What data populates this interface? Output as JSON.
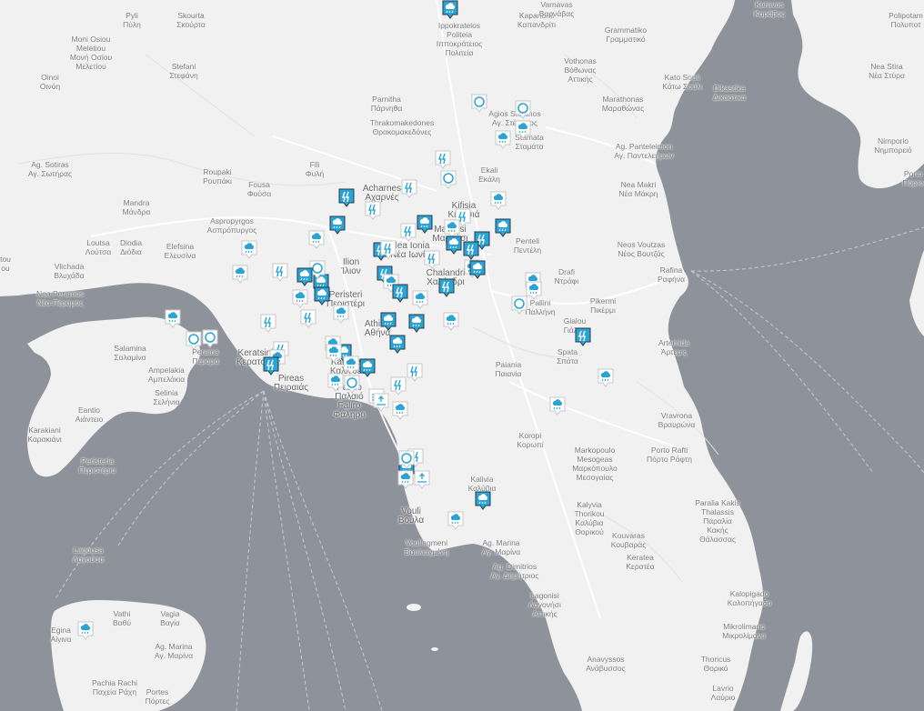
{
  "map": {
    "colors": {
      "sea": "#8e929a",
      "land": "#f1f1f1",
      "road": "#ffffff",
      "accent": "#2aa3d6",
      "markerDark": "#2b3a45"
    },
    "places": [
      {
        "id": "pyli",
        "l1": "Pyli",
        "l2": "Πύλη"
      },
      {
        "id": "skourta",
        "l1": "Skourta",
        "l2": "Σκούρτα"
      },
      {
        "id": "ippokrateios",
        "l1": "Ippokrateios",
        "l2": "Politeia",
        "l3": "Ιπποκράτειος",
        "l4": "Πολιτεία"
      },
      {
        "id": "kapandriti",
        "l1": "Kapandriti",
        "l2": "Καπανδρίτι"
      },
      {
        "id": "varnavas",
        "l1": "Varnavas",
        "l2": "Βαρνάβας"
      },
      {
        "id": "grammatiko",
        "l1": "Grammatiko",
        "l2": "Γραμματικό"
      },
      {
        "id": "polipotamos",
        "l1": "Polipotam",
        "l2": "Πολυποτ"
      },
      {
        "id": "moni",
        "l1": "Moni Osiou",
        "l2": "Meletiou",
        "l3": "Μονή Οσίου",
        "l4": "Μελετίου"
      },
      {
        "id": "stefani",
        "l1": "Stefani",
        "l2": "Στεφάνη"
      },
      {
        "id": "oinoi",
        "l1": "Oinoi",
        "l2": "Οινόη"
      },
      {
        "id": "vothonas",
        "l1": "Vothonas",
        "l2": "Βόθωνας",
        "l3": "Αττικής"
      },
      {
        "id": "katosouli",
        "l1": "Kato Souli",
        "l2": "Κάτω Σούλι"
      },
      {
        "id": "dikastika",
        "l1": "Dikastika",
        "l2": "Δικαστικα"
      },
      {
        "id": "neastira",
        "l1": "Nea Stira",
        "l2": "Νέα Στύρα"
      },
      {
        "id": "parnitha",
        "l1": "Parnitha",
        "l2": "Πάρνηθα"
      },
      {
        "id": "marathonas",
        "l1": "Marathonas",
        "l2": "Μαραθώνας"
      },
      {
        "id": "thrakomakedones",
        "l1": "Thrakomakedones",
        "l2": "Θρακομακεδόνες"
      },
      {
        "id": "agstefanos",
        "l1": "Agios Stefanos",
        "l2": "Αγ. Στέφανος"
      },
      {
        "id": "stamata",
        "l1": "Stamata",
        "l2": "Σταμάτα"
      },
      {
        "id": "nimporio",
        "l1": "Nimporio",
        "l2": "Νημπορειό"
      },
      {
        "id": "agsotiras",
        "l1": "Ag. Sotiras",
        "l2": "Αγ. Σωτήρας"
      },
      {
        "id": "fili",
        "l1": "Fili",
        "l2": "Φυλή"
      },
      {
        "id": "agpanteleimon",
        "l1": "Ag. Panteleimon",
        "l2": "Αγ. Παντελεήμων"
      },
      {
        "id": "ekali",
        "l1": "Ekali",
        "l2": "Εκάλη"
      },
      {
        "id": "roupaki",
        "l1": "Roupaki",
        "l2": "Ρουπάκι"
      },
      {
        "id": "fousa",
        "l1": "Fousa",
        "l2": "Φούσα"
      },
      {
        "id": "acharnes",
        "l1": "Acharnes",
        "l2": "Αχαρνές"
      },
      {
        "id": "neamakri",
        "l1": "Nea Makri",
        "l2": "Νέα Μάκρη"
      },
      {
        "id": "porto",
        "l1": "Porto",
        "l2": "Πόρτο"
      },
      {
        "id": "mandra",
        "l1": "Mandra",
        "l2": "Μάνδρα"
      },
      {
        "id": "kifisia",
        "l1": "Kifisia",
        "l2": "Κηφισιά"
      },
      {
        "id": "aspropyrgos",
        "l1": "Aspropyrgos",
        "l2": "Ασπρόπυργος"
      },
      {
        "id": "marousi",
        "l1": "Marousi",
        "l2": "Μαρούσι"
      },
      {
        "id": "penteli",
        "l1": "Penteli",
        "l2": "Πεντέλη"
      },
      {
        "id": "loutsa",
        "l1": "Loutsa",
        "l2": "Λούτσα"
      },
      {
        "id": "diodia",
        "l1": "Diodia",
        "l2": "Διόδια"
      },
      {
        "id": "elefsina",
        "l1": "Elefsina",
        "l2": "Ελευσίνα"
      },
      {
        "id": "neosvoutzas",
        "l1": "Neos Voutzas",
        "l2": "Νέος Βουτζάς"
      },
      {
        "id": "metamorfosi",
        "l1": "Nea Ionia",
        "l2": "Νέα Ιωνία"
      },
      {
        "id": "outou",
        "l1": "tou",
        "l2": "ου"
      },
      {
        "id": "vlichada",
        "l1": "Vlichada",
        "l2": "Βλυχάδα"
      },
      {
        "id": "ilion",
        "l1": "Ilion",
        "l2": "Ίλιον"
      },
      {
        "id": "chalandri",
        "l1": "Chalandri",
        "l2": "Χαλάνδρι"
      },
      {
        "id": "drafi",
        "l1": "Drafi",
        "l2": "Ντράφι"
      },
      {
        "id": "rafina",
        "l1": "Rafina",
        "l2": "Ραφήνα"
      },
      {
        "id": "neaperamos",
        "l1": "Nea Peramos",
        "l2": "Νέα Πέραμος"
      },
      {
        "id": "peristeri",
        "l1": "Peristeri",
        "l2": "Περιστέρι"
      },
      {
        "id": "pikermi",
        "l1": "Pikermi",
        "l2": "Πικέρμι"
      },
      {
        "id": "pallini",
        "l1": "Pallini",
        "l2": "Παλλήνη"
      },
      {
        "id": "gialou",
        "l1": "Gialou",
        "l2": "Γιάλου"
      },
      {
        "id": "athina",
        "l1": "Athina",
        "l2": "Αθήνα"
      },
      {
        "id": "salamina",
        "l1": "Salamina",
        "l2": "Σαλαμίνα"
      },
      {
        "id": "perama",
        "l1": "Perama",
        "l2": "Πέραμα"
      },
      {
        "id": "keratsini",
        "l1": "Keratsini",
        "l2": "Κερατσίνι"
      },
      {
        "id": "spata",
        "l1": "Spata",
        "l2": "Σπάτα"
      },
      {
        "id": "artemida",
        "l1": "Artemida",
        "l2": "Άρτεμις"
      },
      {
        "id": "ampelakia",
        "l1": "Ampelakia",
        "l2": "Αμπελάκια"
      },
      {
        "id": "kallithea",
        "l1": "Kallithea",
        "l2": "Καλλιθέα"
      },
      {
        "id": "paiania",
        "l1": "Paiania",
        "l2": "Παιανία"
      },
      {
        "id": "pireas",
        "l1": "Pireas",
        "l2": "Πειραιάς"
      },
      {
        "id": "selinia",
        "l1": "Selinia",
        "l2": "Σελήνια"
      },
      {
        "id": "paliofaliro",
        "l1": "Palaio",
        "l2": "Παλαιό",
        "l3": "Faliro",
        "l4": "Φάληρο"
      },
      {
        "id": "eantio",
        "l1": "Eantio",
        "l2": "Αιάντειο"
      },
      {
        "id": "vravrona",
        "l1": "Vravrona",
        "l2": "Βραυρώνα"
      },
      {
        "id": "karakiani",
        "l1": "Karakiani",
        "l2": "Καρακιάνι"
      },
      {
        "id": "koropi",
        "l1": "Koropi",
        "l2": "Κορωπί"
      },
      {
        "id": "markopoulo",
        "l1": "Markopoulo",
        "l2": "Mesogeas",
        "l3": "Μαρκόπουλο",
        "l4": "Μεσογαίας"
      },
      {
        "id": "portorafti",
        "l1": "Porto Rafti",
        "l2": "Πόρτο Ράφτη"
      },
      {
        "id": "peristeria",
        "l1": "Peristeria",
        "l2": "Περιστέρια"
      },
      {
        "id": "kalivia",
        "l1": "Kalivia",
        "l2": "Καλύβια"
      },
      {
        "id": "paralia",
        "l1": "Paralia Kakis",
        "l2": "Thalassis",
        "l3": "Παραλία",
        "l4": "Κακής",
        "l5": "Θάλασσας"
      },
      {
        "id": "vouliagmeni0",
        "l1": "Vouli",
        "l2": "Βούλα"
      },
      {
        "id": "kalyvia",
        "l1": "Kalyvia",
        "l2": "Thorikou",
        "l3": "Καλύβια",
        "l4": "Θορικού"
      },
      {
        "id": "kouvaras",
        "l1": "Kouvaras",
        "l2": "Κουβαράς"
      },
      {
        "id": "vouliagmeni",
        "l1": "Vouliagmeni",
        "l2": "Βουλιαγμένη"
      },
      {
        "id": "agmarina",
        "l1": "Ag. Marina",
        "l2": "Αγ. Μαρίνα"
      },
      {
        "id": "lagousa",
        "l1": "Lagousa",
        "l2": "Λαγούσα"
      },
      {
        "id": "agdimitrios",
        "l1": "Ag. Dimitrios",
        "l2": "Αγ. Δημήτριος"
      },
      {
        "id": "keratea",
        "l1": "Keratea",
        "l2": "Κερατέα"
      },
      {
        "id": "lagonisi",
        "l1": "Lagonisi",
        "l2": "Λαγονήσι",
        "l3": "Αττικής"
      },
      {
        "id": "kalopigado",
        "l1": "Kalopigado",
        "l2": "Καλοπήγαδο"
      },
      {
        "id": "vathi",
        "l1": "Vathi",
        "l2": "Βαθύ"
      },
      {
        "id": "vagia",
        "l1": "Vagia",
        "l2": "Βαγία"
      },
      {
        "id": "mikrolimano",
        "l1": "Mikrolimano",
        "l2": "Μικρολίμανο"
      },
      {
        "id": "egina",
        "l1": "Egina",
        "l2": "Αίγινα"
      },
      {
        "id": "agmarina2",
        "l1": "Ag. Marina",
        "l2": "Αγ. Μαρίνα"
      },
      {
        "id": "anavyssos",
        "l1": "Anavyssos",
        "l2": "Ανάβυσσος"
      },
      {
        "id": "thorikos",
        "l1": "Thoricus",
        "l2": "Θορικό"
      },
      {
        "id": "pachiarachi",
        "l1": "Pachia Rachi",
        "l2": "Παχεία Ράχη"
      },
      {
        "id": "portes",
        "l1": "Portes",
        "l2": "Πόρτες"
      },
      {
        "id": "lavrio",
        "l1": "Lavrio",
        "l2": "Λαύριο"
      },
      {
        "id": "karavos",
        "l1": "Karavos",
        "l2": "Καράβος"
      }
    ],
    "markers": [
      {
        "type": "rain-dark"
      },
      {
        "type": "circle"
      },
      {
        "type": "circle"
      },
      {
        "type": "rain"
      },
      {
        "type": "rain"
      },
      {
        "type": "storm"
      },
      {
        "type": "storm"
      },
      {
        "type": "circle"
      },
      {
        "type": "storm-dark"
      },
      {
        "type": "rain"
      },
      {
        "type": "rain-dark"
      },
      {
        "type": "storm"
      },
      {
        "type": "storm"
      },
      {
        "type": "rain-dark"
      },
      {
        "type": "storm"
      },
      {
        "type": "rain"
      },
      {
        "type": "rain-dark"
      },
      {
        "type": "storm-dark"
      },
      {
        "type": "rain-dark"
      },
      {
        "type": "storm-dark"
      },
      {
        "type": "storm-dark"
      },
      {
        "type": "rain"
      },
      {
        "type": "storm"
      },
      {
        "type": "rain"
      },
      {
        "type": "storm"
      },
      {
        "type": "rain"
      },
      {
        "type": "rain-dark"
      },
      {
        "type": "storm-dark"
      },
      {
        "type": "rain-dark"
      },
      {
        "type": "storm-dark"
      },
      {
        "type": "rain"
      },
      {
        "type": "rain"
      },
      {
        "type": "circle"
      },
      {
        "type": "rain-dark"
      },
      {
        "type": "storm"
      },
      {
        "type": "rain-dark"
      },
      {
        "type": "storm-dark"
      },
      {
        "type": "rain"
      },
      {
        "type": "rain"
      },
      {
        "type": "rain"
      },
      {
        "type": "storm"
      },
      {
        "type": "rain"
      },
      {
        "type": "storm"
      },
      {
        "type": "rain-dark"
      },
      {
        "type": "rain-dark"
      },
      {
        "type": "rain"
      },
      {
        "type": "circle"
      },
      {
        "type": "circle"
      },
      {
        "type": "rain"
      },
      {
        "type": "rain-dark"
      },
      {
        "type": "rain-dark"
      },
      {
        "type": "storm"
      },
      {
        "type": "rain"
      },
      {
        "type": "rain-dark"
      },
      {
        "type": "rain"
      },
      {
        "type": "circle"
      },
      {
        "type": "storm"
      },
      {
        "type": "rain"
      },
      {
        "type": "wind"
      },
      {
        "type": "storm"
      },
      {
        "type": "rain"
      },
      {
        "type": "circle"
      },
      {
        "type": "rain"
      },
      {
        "type": "rain"
      },
      {
        "type": "rain"
      },
      {
        "type": "rain"
      },
      {
        "type": "rain"
      },
      {
        "type": "rain-dark"
      },
      {
        "type": "storm-dark"
      },
      {
        "type": "rain"
      },
      {
        "type": "rain-dark"
      },
      {
        "type": "rain"
      },
      {
        "type": "storm"
      },
      {
        "type": "level"
      },
      {
        "type": "level"
      },
      {
        "type": "rain"
      },
      {
        "type": "storm-dark"
      },
      {
        "type": "circle"
      }
    ]
  }
}
